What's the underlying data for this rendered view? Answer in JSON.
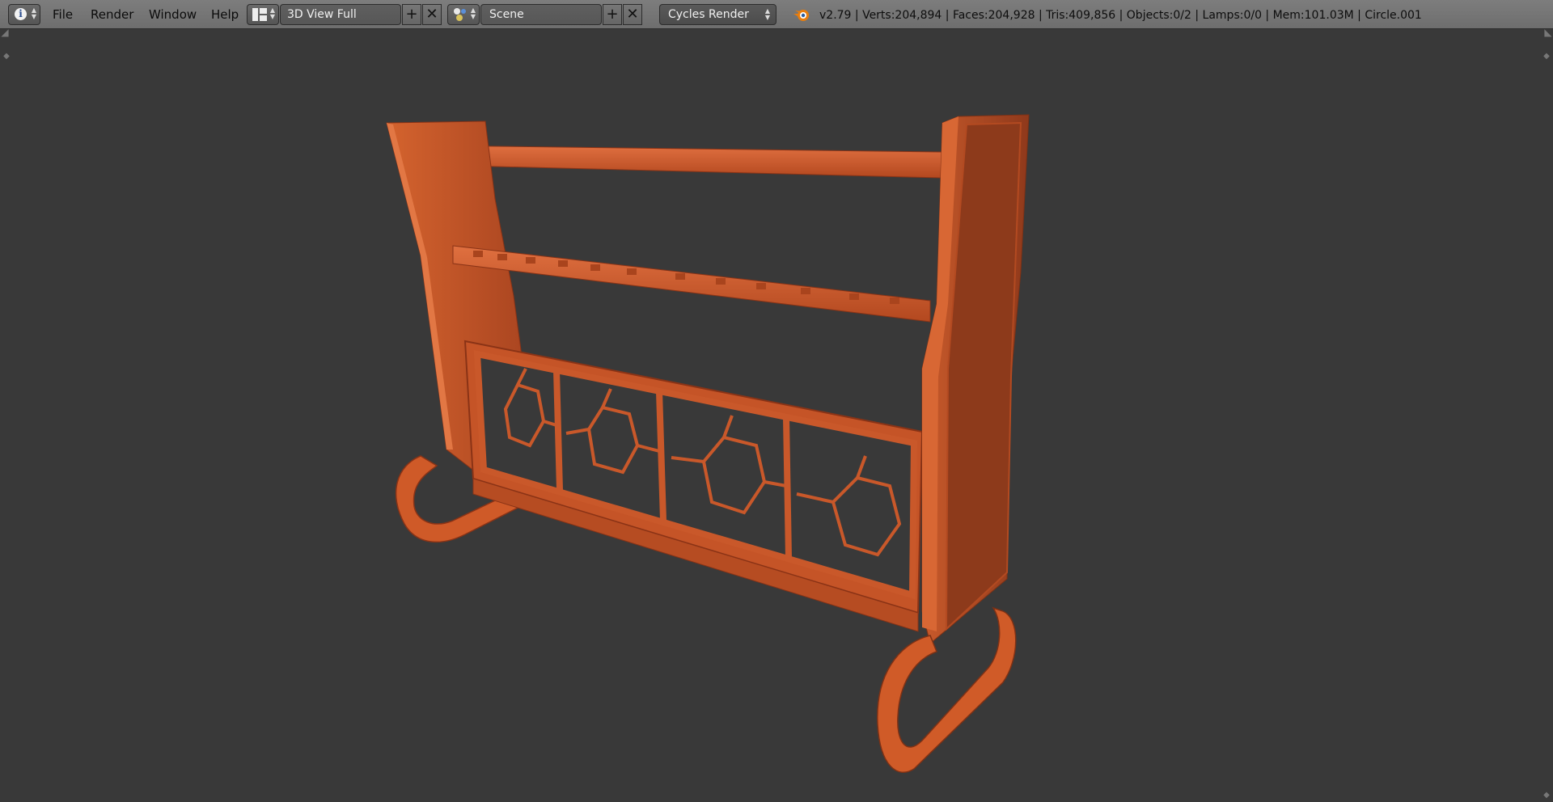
{
  "header": {
    "editor_type_icon": "info-icon",
    "menus": [
      "File",
      "Render",
      "Window",
      "Help"
    ],
    "screen_layout": "3D View Full",
    "scene": "Scene",
    "render_engine": "Cycles Render",
    "stats": "v2.79 | Verts:204,894 | Faces:204,928 | Tris:409,856 | Objects:0/2 | Lamps:0/0 | Mem:101.03M | Circle.001"
  },
  "viewport": {
    "object_color": "#c4532a",
    "background_color": "#393939"
  }
}
